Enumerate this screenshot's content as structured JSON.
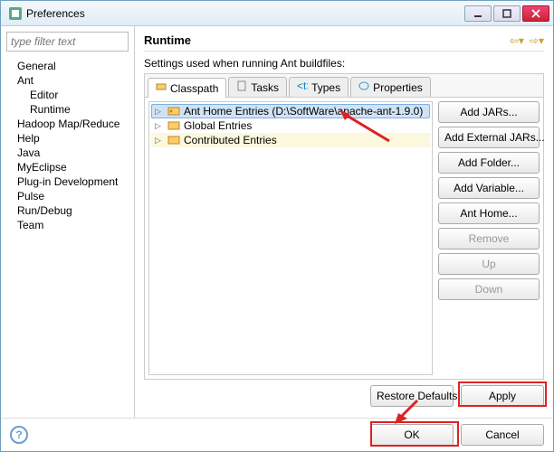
{
  "window": {
    "title": "Preferences"
  },
  "filter": {
    "placeholder": "type filter text"
  },
  "sidebar": {
    "items": [
      {
        "label": "General"
      },
      {
        "label": "Ant"
      },
      {
        "label": "Editor"
      },
      {
        "label": "Runtime"
      },
      {
        "label": "Hadoop Map/Reduce"
      },
      {
        "label": "Help"
      },
      {
        "label": "Java"
      },
      {
        "label": "MyEclipse"
      },
      {
        "label": "Plug-in Development"
      },
      {
        "label": "Pulse"
      },
      {
        "label": "Run/Debug"
      },
      {
        "label": "Team"
      }
    ]
  },
  "page": {
    "heading": "Runtime",
    "desc": "Settings used when running Ant buildfiles:"
  },
  "tabs": [
    {
      "label": "Classpath"
    },
    {
      "label": "Tasks"
    },
    {
      "label": "Types"
    },
    {
      "label": "Properties"
    }
  ],
  "entries": [
    {
      "label": "Ant Home Entries (D:\\SoftWare\\apache-ant-1.9.0)"
    },
    {
      "label": "Global Entries"
    },
    {
      "label": "Contributed Entries"
    }
  ],
  "buttons": {
    "addJars": "Add JARs...",
    "addExternal": "Add External JARs...",
    "addFolder": "Add Folder...",
    "addVariable": "Add Variable...",
    "antHome": "Ant Home...",
    "remove": "Remove",
    "up": "Up",
    "down": "Down",
    "restore": "Restore Defaults",
    "apply": "Apply",
    "ok": "OK",
    "cancel": "Cancel"
  }
}
